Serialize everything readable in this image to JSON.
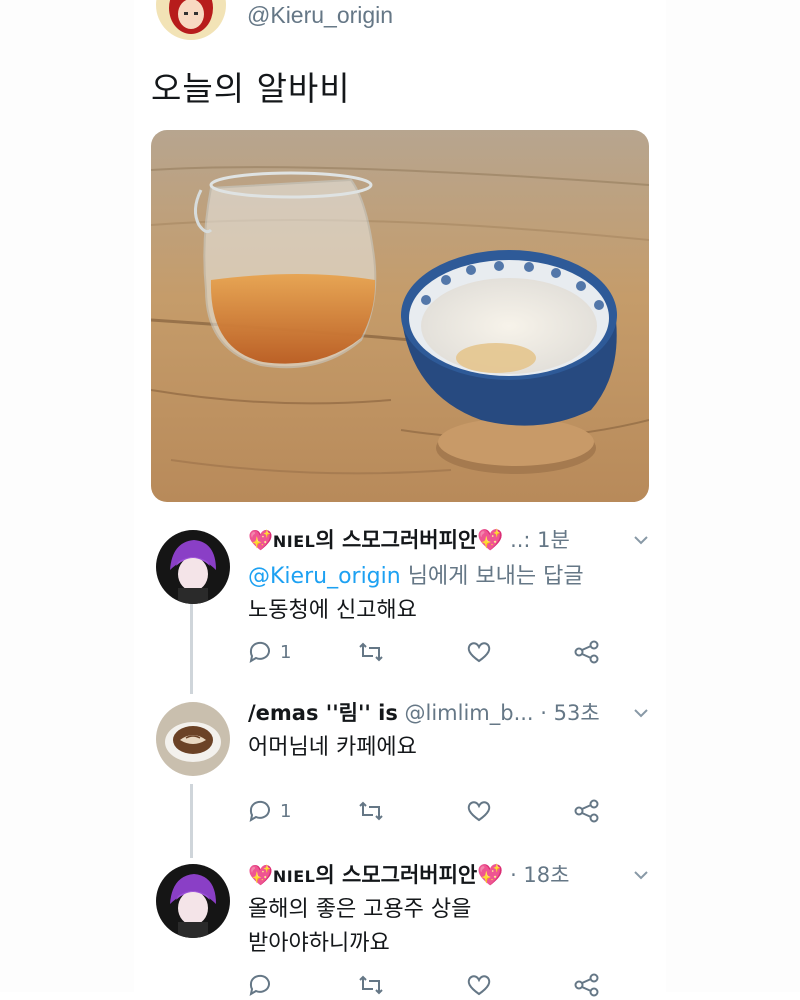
{
  "tweet": {
    "handle": "@Kieru_origin",
    "text": "오늘의 알바비"
  },
  "replies": [
    {
      "name_pre": "💖",
      "name_tag": "NIEL",
      "name_post": "의 스모그러버피안💖",
      "meta": " ..: 1분",
      "lines": [
        "@Kieru_origin 님에게 보내는 답글",
        "노동청에 신고해요"
      ],
      "mention": "@Kieru_origin",
      "reply_prefix_rest": " 님에게 보내는 답글",
      "body": "노동청에 신고해요",
      "reply_count": "1"
    },
    {
      "name": "/emas ''림'' is",
      "meta": " @limlim_b... · 53초",
      "body": "어머님네 카페에요",
      "reply_count": "1"
    },
    {
      "name_pre": "💖",
      "name_tag": "NIEL",
      "name_post": "의 스모그러버피안💖",
      "meta": " · 18초",
      "body_line1": "올해의 좋은 고용주 상을",
      "body_line2": "받아야하니까요",
      "reply_count": ""
    }
  ],
  "icons": [
    "reply-icon",
    "retweet-icon",
    "like-icon",
    "share-icon",
    "chevron-down-icon"
  ],
  "colors": {
    "text": "#14171a",
    "muted": "#657786",
    "link": "#1da1f2",
    "heart": "#c8102e",
    "avatar_purple": "#8a3fc6"
  }
}
